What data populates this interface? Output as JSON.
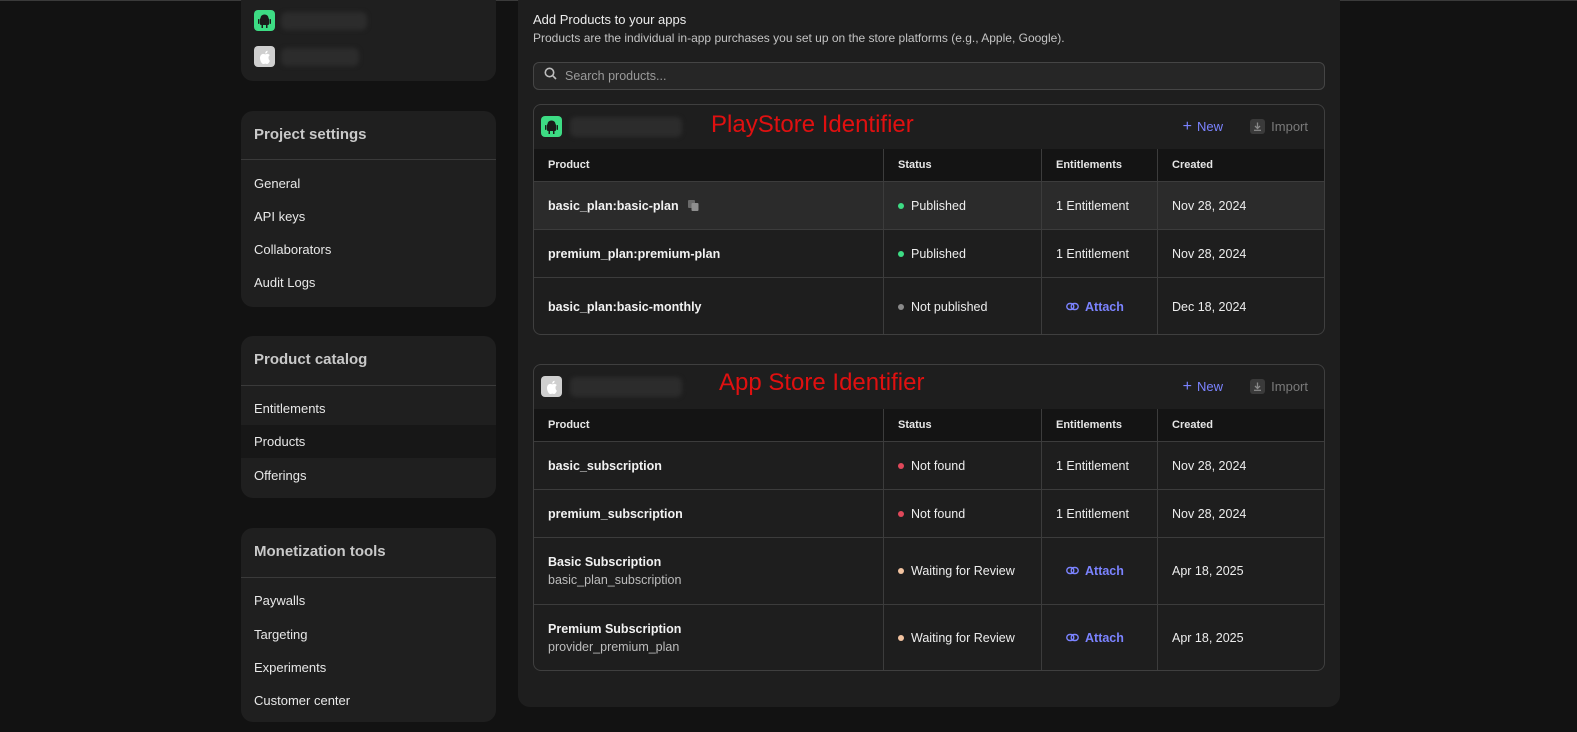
{
  "colors": {
    "published": "#3ddc84",
    "not_published": "#8a8a8a",
    "not_found": "#e0485a",
    "waiting": "#f2c3a0",
    "accent": "#7b83ff",
    "annotation": "#e01010"
  },
  "sidebar": {
    "apps": [
      {
        "icon": "android-icon"
      },
      {
        "icon": "apple-icon"
      }
    ],
    "project_settings": {
      "title": "Project settings",
      "items": [
        "General",
        "API keys",
        "Collaborators",
        "Audit Logs"
      ]
    },
    "product_catalog": {
      "title": "Product catalog",
      "items": [
        "Entitlements",
        "Products",
        "Offerings"
      ],
      "active": "Products"
    },
    "monetization_tools": {
      "title": "Monetization tools",
      "items": [
        "Paywalls",
        "Targeting",
        "Experiments",
        "Customer center"
      ]
    }
  },
  "main": {
    "title": "Add Products to your apps",
    "subtitle": "Products are the individual in-app purchases you set up on the store platforms (e.g., Apple, Google).",
    "search_placeholder": "Search products..."
  },
  "playstore": {
    "annotation": "PlayStore Identifier",
    "new_label": "New",
    "import_label": "Import",
    "columns": [
      "Product",
      "Status",
      "Entitlements",
      "Created"
    ],
    "rows": [
      {
        "product": "basic_plan:basic-plan",
        "status": "Published",
        "entitlements": "1 Entitlement",
        "created": "Nov 28, 2024"
      },
      {
        "product": "premium_plan:premium-plan",
        "status": "Published",
        "entitlements": "1 Entitlement",
        "created": "Nov 28, 2024"
      },
      {
        "product": "basic_plan:basic-monthly",
        "status": "Not published",
        "entitlements": "Attach",
        "created": "Dec 18, 2024"
      }
    ]
  },
  "appstore": {
    "annotation": "App Store Identifier",
    "new_label": "New",
    "import_label": "Import",
    "columns": [
      "Product",
      "Status",
      "Entitlements",
      "Created"
    ],
    "rows": [
      {
        "product": "basic_subscription",
        "status": "Not found",
        "entitlements": "1 Entitlement",
        "created": "Nov 28, 2024"
      },
      {
        "product": "premium_subscription",
        "status": "Not found",
        "entitlements": "1 Entitlement",
        "created": "Nov 28, 2024"
      },
      {
        "product": "Basic Subscription",
        "product_id": "basic_plan_subscription",
        "status": "Waiting for Review",
        "entitlements": "Attach",
        "created": "Apr 18, 2025"
      },
      {
        "product": "Premium Subscription",
        "product_id": "provider_premium_plan",
        "status": "Waiting for Review",
        "entitlements": "Attach",
        "created": "Apr 18, 2025"
      }
    ]
  }
}
